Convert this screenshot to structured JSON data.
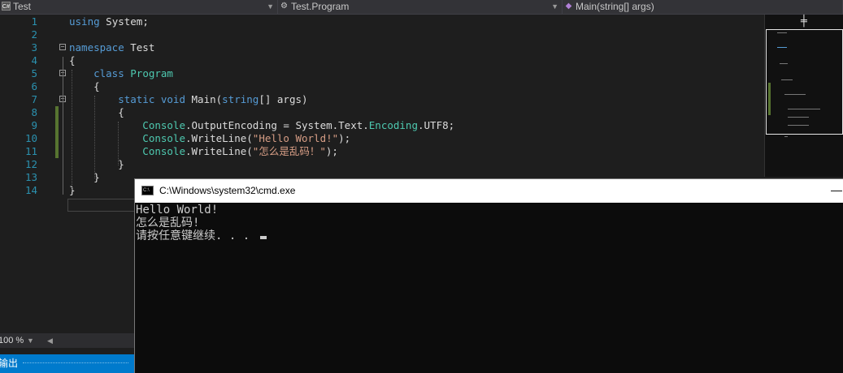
{
  "nav": {
    "project": "Test",
    "class": "Test.Program",
    "member": "Main(string[] args)"
  },
  "editor": {
    "lines": [
      {
        "n": "1",
        "code": [
          {
            "t": "using",
            "c": "kw"
          },
          {
            "t": " System;",
            "c": ""
          }
        ]
      },
      {
        "n": "2",
        "code": []
      },
      {
        "n": "3",
        "code": [
          {
            "t": "namespace",
            "c": "kw"
          },
          {
            "t": " Test",
            "c": ""
          }
        ]
      },
      {
        "n": "4",
        "code": [
          {
            "t": "{",
            "c": ""
          }
        ]
      },
      {
        "n": "5",
        "code": [
          {
            "t": "    class ",
            "c": "kw"
          },
          {
            "t": "Program",
            "c": "ty"
          }
        ]
      },
      {
        "n": "6",
        "code": [
          {
            "t": "    {",
            "c": ""
          }
        ]
      },
      {
        "n": "7",
        "code": [
          {
            "t": "        static void ",
            "c": "kw"
          },
          {
            "t": "Main(",
            "c": ""
          },
          {
            "t": "string",
            "c": "kw"
          },
          {
            "t": "[] args)",
            "c": ""
          }
        ]
      },
      {
        "n": "8",
        "code": [
          {
            "t": "        {",
            "c": ""
          }
        ]
      },
      {
        "n": "9",
        "code": [
          {
            "t": "            Console",
            "c": "ty"
          },
          {
            "t": ".OutputEncoding = System.Text.",
            "c": ""
          },
          {
            "t": "Encoding",
            "c": "ty"
          },
          {
            "t": ".UTF8;",
            "c": ""
          }
        ]
      },
      {
        "n": "10",
        "code": [
          {
            "t": "            Console",
            "c": "ty"
          },
          {
            "t": ".WriteLine(",
            "c": ""
          },
          {
            "t": "\"Hello World!\"",
            "c": "st"
          },
          {
            "t": ");",
            "c": ""
          }
        ]
      },
      {
        "n": "11",
        "code": [
          {
            "t": "            Console",
            "c": "ty"
          },
          {
            "t": ".WriteLine(",
            "c": ""
          },
          {
            "t": "\"怎么是乱码！\"",
            "c": "st"
          },
          {
            "t": ");",
            "c": ""
          }
        ]
      },
      {
        "n": "12",
        "code": [
          {
            "t": "        }",
            "c": ""
          }
        ]
      },
      {
        "n": "13",
        "code": [
          {
            "t": "    }",
            "c": ""
          }
        ]
      },
      {
        "n": "14",
        "code": [
          {
            "t": "}",
            "c": ""
          }
        ]
      }
    ]
  },
  "bottom": {
    "zoom": "100 %",
    "output_tab": "输出"
  },
  "console": {
    "title": "C:\\Windows\\system32\\cmd.exe",
    "minimize": "—",
    "lines": [
      "Hello World!",
      "怎么是乱码!",
      "请按任意键继续. . . "
    ]
  },
  "icons": {
    "class_icon": "class-icon",
    "method_icon": "method-icon",
    "project_icon": "csharp-project-icon"
  }
}
